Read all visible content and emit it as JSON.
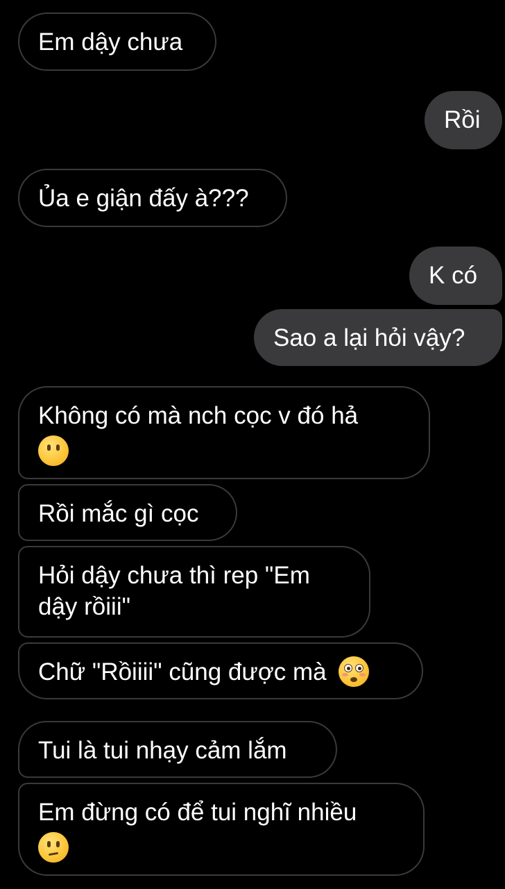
{
  "messages": [
    {
      "side": "in",
      "text": "Em dậy chưa"
    },
    {
      "side": "out",
      "text": "Rồi"
    },
    {
      "side": "in",
      "text": "Ủa e giận đấy à???"
    },
    {
      "side": "out",
      "text": "K có"
    },
    {
      "side": "out",
      "text": "Sao a lại hỏi vậy?"
    },
    {
      "side": "in",
      "text": "Không có mà nch cọc v đó hả",
      "emoji": "neutral-face-no-mouth"
    },
    {
      "side": "in",
      "text": "Rồi mắc gì cọc"
    },
    {
      "side": "in",
      "text_line1": "Hỏi dậy chưa thì rep \"Em",
      "text_line2": "dậy rồiii\""
    },
    {
      "side": "in",
      "text": "Chữ \"Rồiiii\" cũng được mà",
      "emoji": "flushed-face"
    },
    {
      "side": "in",
      "text": "Tui là tui nhạy cảm lắm"
    },
    {
      "side": "in",
      "text": "Em đừng có để tui nghĩ nhiều",
      "emoji": "confused-face"
    }
  ],
  "colors": {
    "background": "#000000",
    "incoming_border": "#3a3a3a",
    "outgoing_fill": "#3a3a3c",
    "text": "#ffffff"
  }
}
